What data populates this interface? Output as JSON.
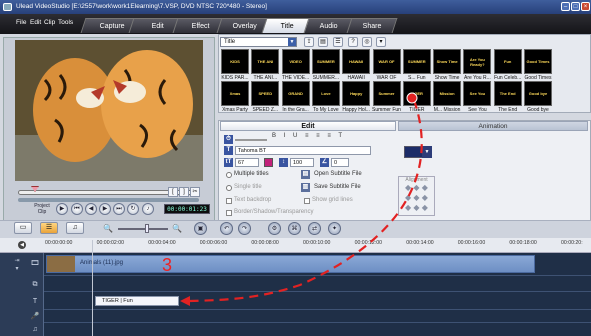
{
  "window": {
    "title": "Ulead VideoStudio [E:\\2557\\work\\work1Elearning\\7.VSP, DVD NTSC 720*480 - Stereo]"
  },
  "menu": [
    "File",
    "Edit",
    "Clip",
    "Tools"
  ],
  "steps": [
    "Capture",
    "Edit",
    "Effect",
    "Overlay",
    "Title",
    "Audio",
    "Share"
  ],
  "active_step": "Title",
  "library": {
    "category": "Title",
    "thumbs_row1": [
      {
        "label": "KIDS PAR...",
        "art": "KIDS"
      },
      {
        "label": "THE ANI...",
        "art": "THE ANI"
      },
      {
        "label": "THE VIDE...",
        "art": "VIDEO"
      },
      {
        "label": "SUMMER...",
        "art": "SUMMER"
      },
      {
        "label": "HAWAII",
        "art": "HAWAII"
      },
      {
        "label": "WAR OF",
        "art": "WAR OF"
      },
      {
        "label": "S... Fun",
        "art": "SUMMER"
      },
      {
        "label": "Show Time",
        "art": "Show Time"
      },
      {
        "label": "Are You R...",
        "art": "Are You Ready?"
      },
      {
        "label": "Fun Celeb...",
        "art": "Fun"
      },
      {
        "label": "Good Times",
        "art": "Good Times"
      }
    ],
    "thumbs_row2": [
      {
        "label": "Xmas Party",
        "art": "Xmas"
      },
      {
        "label": "SPEED Z...",
        "art": "SPEED"
      },
      {
        "label": "In the Gra...",
        "art": "GRAND"
      },
      {
        "label": "To My Love",
        "art": "Love"
      },
      {
        "label": "Happy Hol...",
        "art": "Happy"
      },
      {
        "label": "Summer Fun",
        "art": "Summer"
      },
      {
        "label": "TIGER",
        "art": "TIGER"
      },
      {
        "label": "M... Mission",
        "art": "Mission"
      },
      {
        "label": "See You",
        "art": "See You"
      },
      {
        "label": "The End",
        "art": "The End"
      },
      {
        "label": "Good bye",
        "art": "Good bye"
      }
    ]
  },
  "preview": {
    "project_label": "Project",
    "clip_label": "Clip",
    "timecode": "00:00:01:23",
    "playhead_fraction": 0.08
  },
  "edit_panel": {
    "edit_tab": "Edit",
    "animation_tab": "Animation",
    "font": "Tahoma BT",
    "font_size": "67",
    "line_spacing": "100",
    "angle": "0",
    "multiple_titles": "Multiple titles",
    "single_title": "Single title",
    "text_backdrop": "Text backdrop",
    "show_grid": "Show grid lines",
    "open_subtitle": "Open Subtitle File",
    "save_subtitle": "Save Subtitle File",
    "border_shadow": "Border/Shadow/Transparency",
    "alignment": "Alignment",
    "color": "#1c2c68"
  },
  "timeline": {
    "ticks": [
      "00:00:00:00",
      "00:00:02:00",
      "00:00:04:00",
      "00:00:06:00",
      "00:00:08:00",
      "00:00:10:00",
      "00:00:12:00",
      "00:00:14:00",
      "00:00:16:00",
      "00:00:18:00",
      "00:00:20:"
    ],
    "video_clip": "Animals (11).jpg",
    "title_clip": "TIGER | Fun"
  },
  "annotation": {
    "number": "3",
    "color": "#e22222"
  }
}
